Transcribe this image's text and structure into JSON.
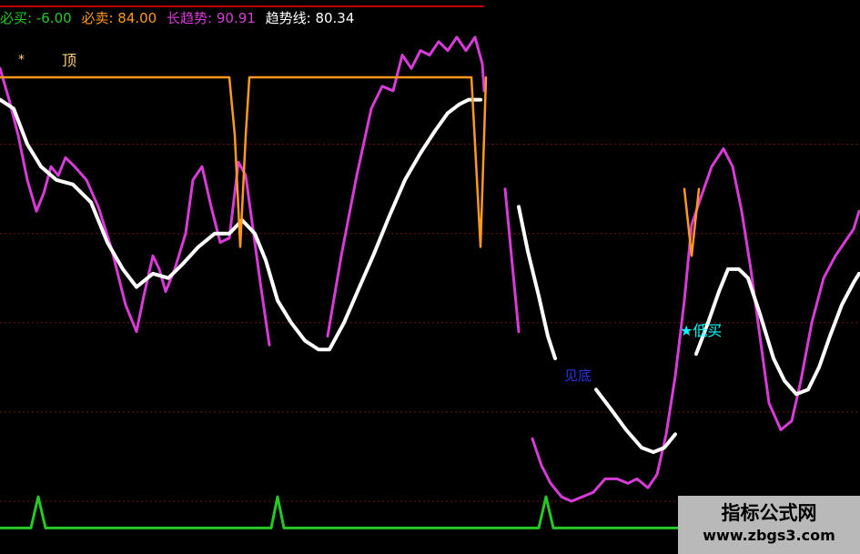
{
  "legend": {
    "buy_label": "必买:",
    "buy_value": "-6.00",
    "sell_label": "必卖:",
    "sell_value": "84.00",
    "long_trend_label": "长趋势:",
    "long_trend_value": "90.91",
    "trend_line_label": "趋势线:",
    "trend_line_value": "80.34"
  },
  "colors": {
    "buy": "#26c826",
    "sell": "#ff9a1e",
    "long_trend": "#d83bd8",
    "trend_line": "#ffffff",
    "cyan": "#00ffff",
    "blue_text": "#2c32e6",
    "grid": "#7a1010",
    "top_line": "#c00000"
  },
  "annotations": {
    "star": "*",
    "top": "顶",
    "low_buy": "★低买",
    "bottom": "见底"
  },
  "watermark": {
    "title": "指标公式网",
    "url": "www.zbgs3.com"
  },
  "chart_data": {
    "type": "line",
    "ylim": [
      -10,
      105
    ],
    "x_count": 945,
    "series": [
      {
        "name": "长趋势",
        "color": "#d83bd8",
        "width": 3,
        "segments": [
          [
            [
              0,
              97
            ],
            [
              10,
              90
            ],
            [
              20,
              82
            ],
            [
              30,
              72
            ],
            [
              40,
              65
            ],
            [
              48,
              69
            ],
            [
              56,
              75
            ],
            [
              64,
              73
            ],
            [
              72,
              77
            ],
            [
              82,
              75
            ],
            [
              95,
              72
            ],
            [
              108,
              66
            ],
            [
              122,
              57
            ],
            [
              138,
              44
            ],
            [
              150,
              38
            ],
            [
              158,
              46
            ],
            [
              168,
              55
            ],
            [
              175,
              52
            ],
            [
              182,
              47
            ],
            [
              192,
              52
            ],
            [
              204,
              60
            ],
            [
              212,
              72
            ],
            [
              222,
              75
            ],
            [
              232,
              66
            ],
            [
              242,
              58
            ],
            [
              252,
              59
            ],
            [
              262,
              76
            ],
            [
              270,
              73
            ],
            [
              278,
              61
            ],
            [
              286,
              49
            ],
            [
              296,
              35
            ]
          ],
          [
            [
              360,
              37
            ],
            [
              375,
              55
            ],
            [
              392,
              73
            ],
            [
              408,
              88
            ],
            [
              420,
              93
            ],
            [
              432,
              92
            ],
            [
              442,
              100
            ],
            [
              452,
              97
            ],
            [
              462,
              101
            ],
            [
              472,
              100
            ],
            [
              482,
              103
            ],
            [
              492,
              101
            ],
            [
              502,
              104
            ],
            [
              512,
              101
            ],
            [
              522,
              104
            ],
            [
              530,
              98
            ],
            [
              532,
              92
            ]
          ],
          [
            [
              555,
              70
            ],
            [
              562,
              55
            ],
            [
              570,
              38
            ]
          ],
          [
            [
              585,
              14
            ],
            [
              595,
              8
            ],
            [
              605,
              4
            ],
            [
              617,
              1
            ],
            [
              628,
              0
            ],
            [
              640,
              1
            ],
            [
              652,
              2
            ],
            [
              665,
              5
            ],
            [
              678,
              5
            ],
            [
              690,
              4
            ],
            [
              700,
              5
            ],
            [
              712,
              3
            ],
            [
              722,
              6
            ],
            [
              732,
              15
            ],
            [
              742,
              28
            ],
            [
              752,
              45
            ],
            [
              760,
              62
            ],
            [
              770,
              68
            ],
            [
              782,
              75
            ],
            [
              795,
              79
            ],
            [
              805,
              75
            ],
            [
              815,
              65
            ],
            [
              825,
              52
            ],
            [
              835,
              37
            ],
            [
              845,
              22
            ],
            [
              858,
              16
            ],
            [
              870,
              18
            ],
            [
              880,
              27
            ],
            [
              892,
              40
            ],
            [
              905,
              50
            ],
            [
              918,
              55
            ],
            [
              928,
              58
            ],
            [
              938,
              61
            ],
            [
              944,
              65
            ]
          ]
        ]
      },
      {
        "name": "趋势线",
        "color": "#ffffff",
        "width": 4,
        "segments": [
          [
            [
              0,
              90
            ],
            [
              15,
              88
            ],
            [
              30,
              80
            ],
            [
              45,
              75
            ],
            [
              62,
              72
            ],
            [
              80,
              71
            ],
            [
              100,
              67
            ],
            [
              118,
              58
            ],
            [
              135,
              52
            ],
            [
              150,
              48
            ],
            [
              168,
              51
            ],
            [
              185,
              50
            ],
            [
              200,
              53
            ],
            [
              218,
              57
            ],
            [
              236,
              60
            ],
            [
              252,
              60
            ],
            [
              266,
              63
            ],
            [
              280,
              60
            ],
            [
              292,
              54
            ],
            [
              305,
              45
            ],
            [
              320,
              40
            ],
            [
              335,
              36
            ],
            [
              350,
              34
            ],
            [
              362,
              34
            ],
            [
              378,
              40
            ],
            [
              395,
              48
            ],
            [
              410,
              55
            ],
            [
              428,
              64
            ],
            [
              445,
              72
            ],
            [
              462,
              78
            ],
            [
              478,
              83
            ],
            [
              492,
              87
            ],
            [
              505,
              89
            ],
            [
              515,
              90
            ],
            [
              528,
              90
            ]
          ],
          [
            [
              570,
              66
            ],
            [
              580,
              56
            ],
            [
              592,
              46
            ],
            [
              602,
              37
            ],
            [
              610,
              32
            ]
          ],
          [
            [
              655,
              25
            ],
            [
              670,
              21
            ],
            [
              688,
              16
            ],
            [
              705,
              12
            ],
            [
              718,
              11
            ],
            [
              730,
              12
            ],
            [
              742,
              15
            ]
          ],
          [
            [
              765,
              33
            ],
            [
              778,
              40
            ],
            [
              790,
              47
            ],
            [
              800,
              52
            ],
            [
              812,
              52
            ],
            [
              822,
              50
            ],
            [
              835,
              42
            ],
            [
              850,
              32
            ],
            [
              862,
              27
            ],
            [
              875,
              24
            ],
            [
              888,
              25
            ],
            [
              900,
              30
            ],
            [
              912,
              37
            ],
            [
              925,
              44
            ],
            [
              938,
              49
            ],
            [
              944,
              51
            ]
          ]
        ]
      },
      {
        "name": "必卖",
        "color": "#ff9a1e",
        "width": 2.5,
        "segments": [
          [
            [
              0,
              95
            ],
            [
              252,
              95
            ],
            [
              258,
              82
            ],
            [
              264,
              57
            ],
            [
              270,
              82
            ],
            [
              274,
              95
            ],
            [
              518,
              95
            ],
            [
              522,
              80
            ],
            [
              528,
              57
            ],
            [
              532,
              82
            ],
            [
              534,
              95
            ]
          ],
          [
            [
              752,
              70
            ],
            [
              760,
              55
            ],
            [
              768,
              70
            ]
          ]
        ]
      },
      {
        "name": "必买",
        "color": "#26c826",
        "width": 3,
        "segments": [
          [
            [
              0,
              -6
            ],
            [
              34,
              -6
            ],
            [
              42,
              1
            ],
            [
              50,
              -6
            ],
            [
              298,
              -6
            ],
            [
              305,
              1
            ],
            [
              312,
              -6
            ],
            [
              592,
              -6
            ],
            [
              600,
              1
            ],
            [
              608,
              -6
            ],
            [
              745,
              -6
            ]
          ]
        ]
      }
    ],
    "grid_levels": [
      80,
      60,
      40,
      20,
      0
    ]
  }
}
